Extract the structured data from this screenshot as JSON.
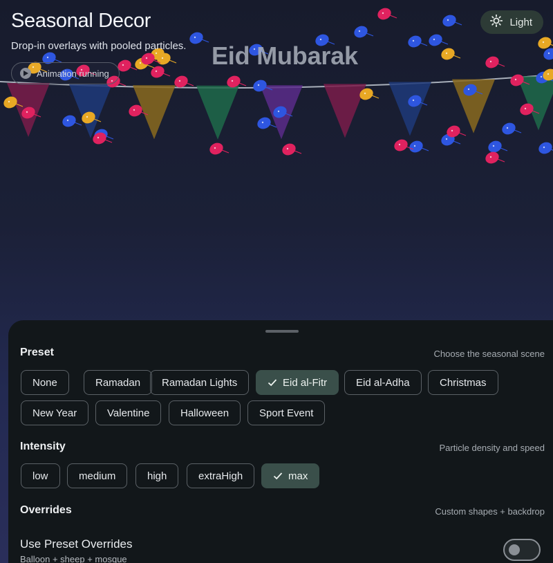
{
  "header": {
    "title": "Seasonal Decor",
    "subtitle": "Drop-in overlays with pooled particles.",
    "animation_status": "Animation running",
    "theme_toggle_label": "Light"
  },
  "overlay": {
    "greeting": "Eid Mubarak",
    "pennant_colors": [
      "#7a1c4a",
      "#1f3a7a",
      "#8a6a1e",
      "#1e6a4a",
      "#5a2c8a",
      "#7a1c4a",
      "#1f3a7a",
      "#8a6a1e",
      "#1e6a4a"
    ],
    "balloon_colors": {
      "pink": "#e0225f",
      "blue": "#2e56e0",
      "gold": "#e8a824"
    }
  },
  "sheet": {
    "preset": {
      "title": "Preset",
      "hint": "Choose the seasonal scene",
      "options": [
        "None",
        "Ramadan",
        "Ramadan Lights",
        "Eid al-Fitr",
        "Eid al-Adha",
        "Christmas",
        "New Year",
        "Valentine",
        "Halloween",
        "Sport Event"
      ],
      "selected": "Eid al-Fitr"
    },
    "intensity": {
      "title": "Intensity",
      "hint": "Particle density and speed",
      "options": [
        "low",
        "medium",
        "high",
        "extraHigh",
        "max"
      ],
      "selected": "max"
    },
    "overrides": {
      "title": "Overrides",
      "hint": "Custom shapes + backdrop",
      "toggle_label": "Use Preset Overrides",
      "toggle_sub": "Balloon + sheep + mosque",
      "toggle_on": false
    }
  },
  "colors": {
    "accent_selected": "#3a4f4a",
    "sheet_bg": "#12171a"
  }
}
